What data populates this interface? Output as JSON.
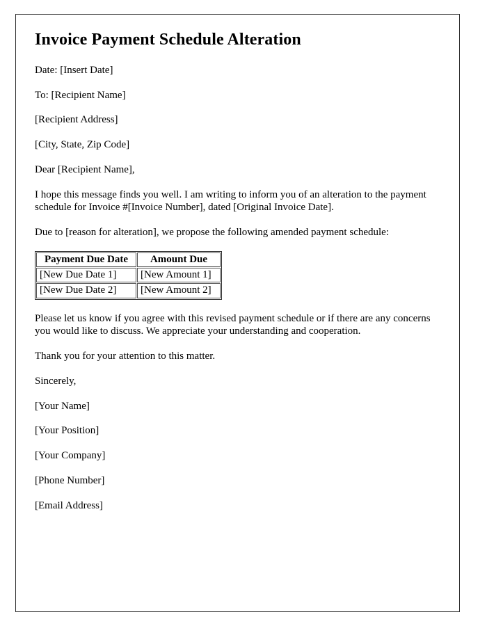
{
  "document": {
    "title": "Invoice Payment Schedule Alteration",
    "blocks": [
      {
        "name": "date-line",
        "text": "Date: [Insert Date]"
      },
      {
        "name": "recipient-name-line",
        "text": "To: [Recipient Name]"
      },
      {
        "name": "recipient-address-line",
        "text": "[Recipient Address]"
      },
      {
        "name": "recipient-city-line",
        "text": "[City, State, Zip Code]"
      },
      {
        "name": "salutation-line",
        "text": "Dear [Recipient Name],"
      },
      {
        "name": "intro-paragraph",
        "text": "I hope this message finds you well. I am writing to inform you of an alteration to the payment schedule for Invoice #[Invoice Number], dated [Original Invoice Date]."
      },
      {
        "name": "reason-paragraph",
        "text": "Due to [reason for alteration], we propose the following amended payment schedule:"
      }
    ],
    "closing_blocks": [
      {
        "name": "request-paragraph",
        "text": "Please let us know if you agree with this revised payment schedule or if there are any concerns you would like to discuss. We appreciate your understanding and cooperation."
      },
      {
        "name": "thanks-paragraph",
        "text": "Thank you for your attention to this matter."
      },
      {
        "name": "signoff-line",
        "text": "Sincerely,"
      },
      {
        "name": "your-name-line",
        "text": "[Your Name]"
      },
      {
        "name": "your-position-line",
        "text": "[Your Position]"
      },
      {
        "name": "your-company-line",
        "text": "[Your Company]"
      },
      {
        "name": "phone-number-line",
        "text": "[Phone Number]"
      },
      {
        "name": "email-address-line",
        "text": "[Email Address]"
      }
    ]
  },
  "schedule_table": {
    "headers": [
      "Payment Due Date",
      "Amount Due"
    ],
    "rows": [
      [
        "[New Due Date 1]",
        "[New Amount 1]"
      ],
      [
        "[New Due Date 2]",
        "[New Amount 2]"
      ]
    ]
  },
  "colors": {
    "page_border": "#2b2b2b",
    "table_border": "#555555",
    "text": "#000000",
    "background": "#ffffff"
  }
}
